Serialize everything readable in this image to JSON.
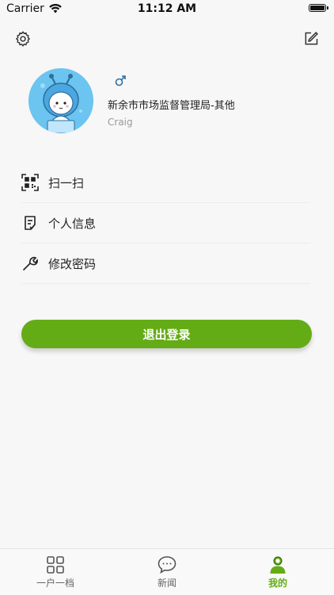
{
  "status_bar": {
    "carrier": "Carrier",
    "time": "11:12 AM"
  },
  "profile": {
    "org": "新余市市场监督管理局-其他",
    "name": "Craig"
  },
  "menu": {
    "items": [
      {
        "label": "扫一扫",
        "icon": "qr-scan-icon"
      },
      {
        "label": "个人信息",
        "icon": "document-icon"
      },
      {
        "label": "修改密码",
        "icon": "wrench-icon"
      }
    ]
  },
  "logout": {
    "label": "退出登录"
  },
  "tabs": [
    {
      "label": "一户一档",
      "icon": "grid-icon",
      "active": false
    },
    {
      "label": "新闻",
      "icon": "chat-bubble-icon",
      "active": false
    },
    {
      "label": "我的",
      "icon": "user-icon",
      "active": true
    }
  ],
  "colors": {
    "accent": "#64ac16",
    "background": "#f7f7f7"
  }
}
